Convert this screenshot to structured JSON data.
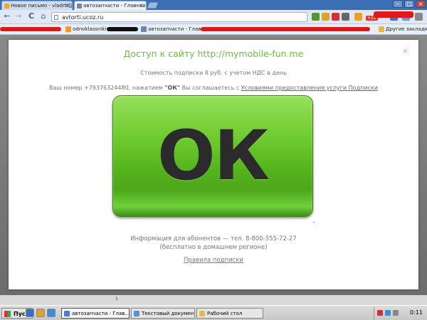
{
  "browser": {
    "tabs": [
      {
        "label": "Новое письмо - vladrti@mai...",
        "close": "×",
        "active": false,
        "favicon_color": "#f5a623"
      },
      {
        "label": "автозапчасти - Главная стр",
        "close": "×",
        "active": true,
        "favicon_color": "#6c86b8"
      }
    ],
    "window_buttons": {
      "minimize": "–",
      "maximize": "□",
      "close": "×"
    },
    "nav": {
      "back": "←",
      "forward": "→",
      "reload": "C",
      "home": "⌂"
    },
    "address": "avtorti.ucoz.ru",
    "extension_badge": "+21",
    "bookmarks": [
      {
        "label": "odnoklassniki",
        "icon_color": "#f59a23"
      },
      {
        "label": "автозапчасти - Главн...",
        "icon_color": "#6c86b8"
      }
    ],
    "other_bookmarks": "Другие закладки",
    "redaction_color": "#e01818"
  },
  "modal": {
    "close": "×",
    "title": "Доступ к сайту http://mymobile-fun.me",
    "price": "Стоимость подписки 8 руб. с учетом НДС в день",
    "terms_prefix": "Ваш номер +79376324480, нажатием ",
    "terms_ok": "\"ОК\"",
    "terms_middle": " Вы соглашаетесь с ",
    "terms_link": "Условиями предоставления услуги Подписки",
    "ok_label": "ОК",
    "info_line1": "Информация для абонентов — тел. 8-800-555-72-27",
    "info_line2": "(бесплатно в домашнем регионе)",
    "rules_link": "Правила подписки",
    "accent_color": "#66c23a",
    "button_color": "#5cc224"
  },
  "page_tail": "1",
  "taskbar": {
    "start": "Пуск",
    "tasks": [
      {
        "label": "автозапчасти - Глав...",
        "active": true,
        "icon_color": "#4a7fd0"
      },
      {
        "label": "Текстовый документ.t...",
        "active": false,
        "icon_color": "#5b8fd6"
      },
      {
        "label": "Рабочий стол",
        "active": false,
        "icon_color": "#e6b94a"
      }
    ],
    "clock": "0:11"
  }
}
